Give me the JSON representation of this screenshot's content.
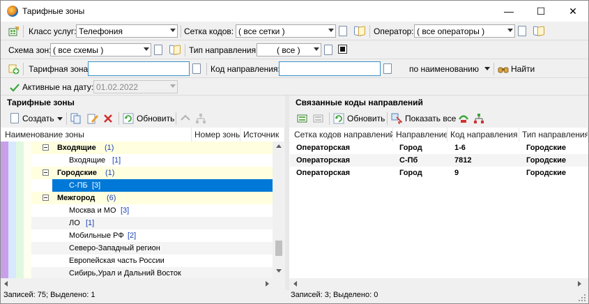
{
  "window": {
    "title": "Тарифные зоны",
    "minimize_glyph": "—",
    "maximize_glyph": "☐",
    "close_glyph": "✕"
  },
  "filters": {
    "service_class_label": "Класс услуг:",
    "service_class_value": "Телефония",
    "code_grid_label": "Сетка кодов:",
    "code_grid_value": "( все сетки )",
    "operator_label": "Оператор:",
    "operator_value": "( все операторы )",
    "zone_scheme_label": "Схема зон:",
    "zone_scheme_value": "( все схемы )",
    "direction_type_label": "Тип направления:",
    "direction_type_value": "( все )",
    "tariff_zone_label": "Тарифная зона:",
    "tariff_zone_value": "",
    "direction_code_label": "Код направления:",
    "direction_code_value": "",
    "search_mode_value": "по наименованию",
    "find_label": "Найти",
    "active_on_date_label": "Активные на дату:",
    "active_on_date_value": "01.02.2022"
  },
  "left_panel": {
    "title": "Тарифные зоны",
    "toolbar": {
      "create_label": "Создать",
      "refresh_label": "Обновить"
    },
    "columns": [
      "Наименование зоны",
      "Номер зоны",
      "Источник"
    ],
    "rows": [
      {
        "level": 1,
        "name": "Входящие",
        "count": "(1)",
        "group": true,
        "selected": false
      },
      {
        "level": 2,
        "name": "Входящие",
        "count": "[1]",
        "group": false,
        "selected": false
      },
      {
        "level": 1,
        "name": "Городские",
        "count": "(1)",
        "group": true,
        "selected": false
      },
      {
        "level": 2,
        "name": "С-ПБ",
        "count": "[3]",
        "group": false,
        "selected": true
      },
      {
        "level": 1,
        "name": "Межгород",
        "count": "(6)",
        "group": true,
        "selected": false
      },
      {
        "level": 2,
        "name": "Москва и МО",
        "count": "[3]",
        "group": false,
        "selected": false
      },
      {
        "level": 2,
        "name": "ЛО",
        "count": "[1]",
        "group": false,
        "selected": false
      },
      {
        "level": 2,
        "name": "Мобильные РФ",
        "count": "[2]",
        "group": false,
        "selected": false
      },
      {
        "level": 2,
        "name": "Северо-Западный регион",
        "count": "",
        "group": false,
        "selected": false
      },
      {
        "level": 2,
        "name": "Европейская часть России",
        "count": "",
        "group": false,
        "selected": false
      },
      {
        "level": 2,
        "name": "Сибирь,Урал и Дальний Восток",
        "count": "",
        "group": false,
        "selected": false
      }
    ],
    "status": "Записей: 75; Выделено: 1"
  },
  "right_panel": {
    "title": "Связанные коды направлений",
    "toolbar": {
      "refresh_label": "Обновить",
      "show_all_label": "Показать все"
    },
    "columns": [
      "Сетка кодов направлений",
      "Направление",
      "Код направления",
      "Тип направления"
    ],
    "rows": [
      [
        "Операторская",
        "Город",
        "1-6",
        "Городские"
      ],
      [
        "Операторская",
        "С-Пб",
        "7812",
        "Городские"
      ],
      [
        "Операторская",
        "Город",
        "9",
        "Городские"
      ]
    ],
    "status": "Записей: 3; Выделено: 0"
  },
  "colors": {
    "selection": "#0078d7",
    "group_row_bg": "#ffffe0",
    "count_text": "#1a3fb8",
    "input_focus_border": "#3a8fc8"
  }
}
